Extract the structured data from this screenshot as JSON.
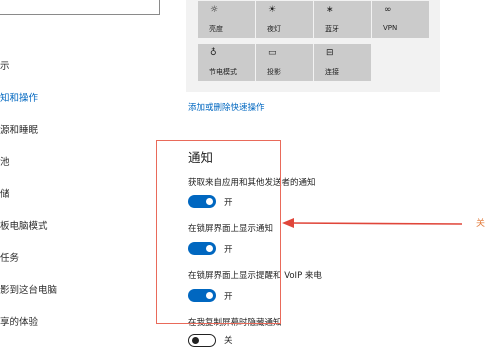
{
  "nav": {
    "items": [
      {
        "label": "示",
        "active": false
      },
      {
        "label": "知和操作",
        "active": true
      },
      {
        "label": "源和睡眠",
        "active": false
      },
      {
        "label": "池",
        "active": false
      },
      {
        "label": "储",
        "active": false
      },
      {
        "label": "板电脑模式",
        "active": false
      },
      {
        "label": "任务",
        "active": false
      },
      {
        "label": "影到这台电脑",
        "active": false
      },
      {
        "label": "享的体验",
        "active": false
      }
    ]
  },
  "quick_actions": {
    "tiles": [
      {
        "label": "亮度",
        "icon": "brightness-icon",
        "glyph": "☼"
      },
      {
        "label": "夜灯",
        "icon": "night-light-icon",
        "glyph": "☀"
      },
      {
        "label": "蓝牙",
        "icon": "bluetooth-icon",
        "glyph": "∗"
      },
      {
        "label": "VPN",
        "icon": "vpn-icon",
        "glyph": "∞"
      },
      {
        "label": "节电模式",
        "icon": "battery-saver-icon",
        "glyph": "♁"
      },
      {
        "label": "投影",
        "icon": "project-icon",
        "glyph": "▭"
      },
      {
        "label": "连接",
        "icon": "connect-icon",
        "glyph": "⊟"
      }
    ],
    "edit_link": "添加或删除快速操作"
  },
  "notifications": {
    "title": "通知",
    "settings": [
      {
        "label": "获取来自应用和其他发送者的通知",
        "state": "开",
        "on": true
      },
      {
        "label": "在锁屏界面上显示通知",
        "state": "开",
        "on": true
      },
      {
        "label": "在锁屏界面上显示提醒和 VoIP 来电",
        "state": "开",
        "on": true
      },
      {
        "label": "在我复制屏幕时隐藏通知",
        "state": "关",
        "on": false
      }
    ]
  },
  "annotation": {
    "text": "关",
    "color": "#e27a3a"
  }
}
